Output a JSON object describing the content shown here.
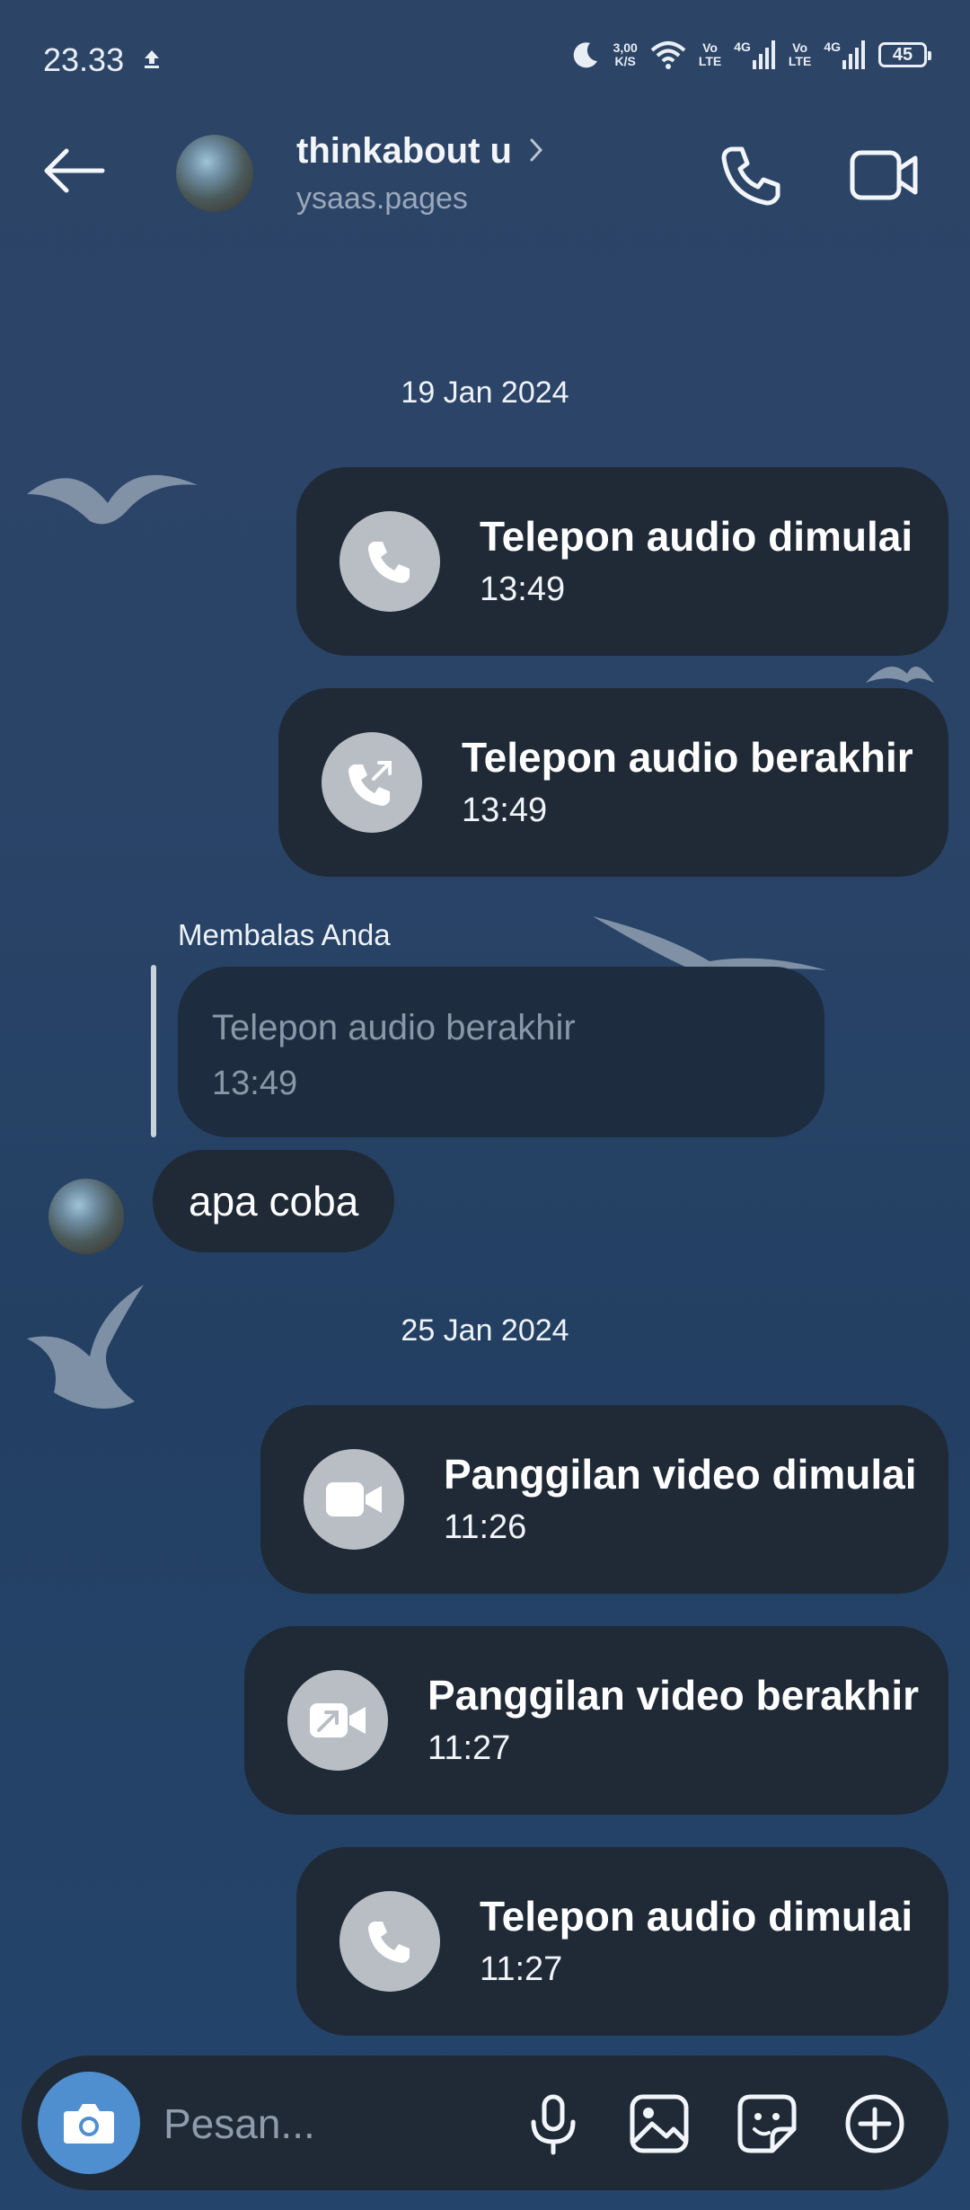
{
  "status_bar": {
    "time": "23.33",
    "net_speed_value": "3,00",
    "net_speed_unit": "K/S",
    "volte1": "Vo",
    "volte1b": "LTE",
    "sig1": "4G",
    "volte2": "Vo",
    "volte2b": "LTE",
    "sig2": "4G",
    "battery": "45",
    "icons": [
      "upload-icon",
      "moon-icon",
      "wifi-icon",
      "signal-icon",
      "battery-icon"
    ]
  },
  "header": {
    "name": "thinkabout u",
    "username": "ysaas.pages",
    "icons": [
      "back-arrow-icon",
      "chevron-right-icon",
      "phone-icon",
      "video-camera-icon"
    ]
  },
  "messages": {
    "date1": "19 Jan 2024",
    "call1": {
      "title": "Telepon audio dimulai",
      "time": "13:49",
      "icon": "phone-icon"
    },
    "call2": {
      "title": "Telepon audio berakhir",
      "time": "13:49",
      "icon": "phone-outgoing-icon"
    },
    "reply_label": "Membalas Anda",
    "reply_quote": {
      "title": "Telepon audio berakhir",
      "time": "13:49"
    },
    "text_msg": "apa coba",
    "date2": "25 Jan 2024",
    "call3": {
      "title": "Panggilan video dimulai",
      "time": "11:26",
      "icon": "video-icon"
    },
    "call4": {
      "title": "Panggilan video berakhir",
      "time": "11:27",
      "icon": "video-outgoing-icon"
    },
    "call5": {
      "title": "Telepon audio dimulai",
      "time": "11:27",
      "icon": "phone-icon"
    }
  },
  "composer": {
    "placeholder": "Pesan...",
    "icons": [
      "camera-icon",
      "microphone-icon",
      "gallery-icon",
      "sticker-icon",
      "plus-circle-icon"
    ]
  },
  "colors": {
    "background": "#2a4468",
    "bubble": "#1f2a36",
    "camera_button": "#4f8fd0",
    "icon_circle": "#b9bec5"
  }
}
